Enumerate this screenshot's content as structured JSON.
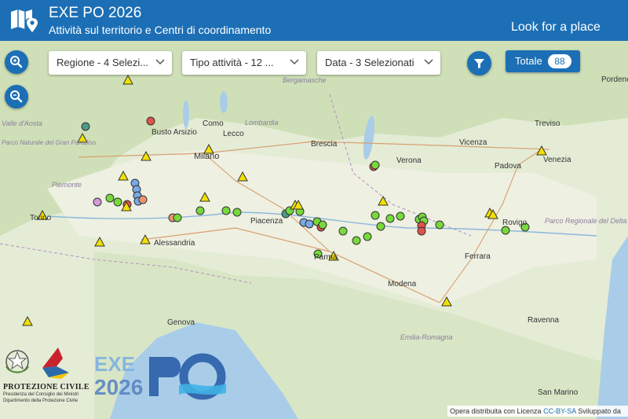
{
  "header": {
    "title": "EXE PO 2026",
    "subtitle": "Attività sul territorio e Centri di coordinamento",
    "search_link": "Look for a place"
  },
  "controls": {
    "filters": [
      {
        "label": "Regione - 4 Selezi..."
      },
      {
        "label": "Tipo attività - 12 ..."
      },
      {
        "label": "Data - 3 Selezionati"
      }
    ],
    "total_label": "Totale",
    "total_count": "88"
  },
  "map": {
    "place_labels": [
      "Lecco",
      "Busto Arsizio",
      "Como",
      "Milano",
      "Lombardia",
      "Bergamasche",
      "Brescia",
      "Verona",
      "Vicenza",
      "Padova",
      "Treviso",
      "Venezia",
      "Pordenone",
      "Piacenza",
      "Alessandria",
      "Modena",
      "Ferrara",
      "Parco Regionale del Delta del Po",
      "Emilia-Romagna",
      "Ravenna",
      "Genova",
      "San Marino",
      "Piemonte",
      "Valle d'Aosta",
      "Parco Naturale del Gran Paradiso",
      "Torino",
      "Parma",
      "Rovigo"
    ]
  },
  "attribution": {
    "text": "Opera distribuita con Licenza",
    "license": "CC-BY-SA",
    "suffix": "Sviluppato da"
  },
  "logos": {
    "pc_name": "PROTEZIONE CIVILE",
    "pc_line1": "Presidenza del Consiglio dei Ministri",
    "pc_line2": "Dipartimento della Protezione Civile",
    "exe_logo_text": "EXE PO 2026"
  },
  "colors": {
    "header": "#1c6fb5",
    "marker_green": "#77d93b",
    "marker_blue": "#79a9e6",
    "marker_red": "#e0524a",
    "marker_yellow": "#f2e000",
    "marker_orange": "#f0956a"
  }
}
